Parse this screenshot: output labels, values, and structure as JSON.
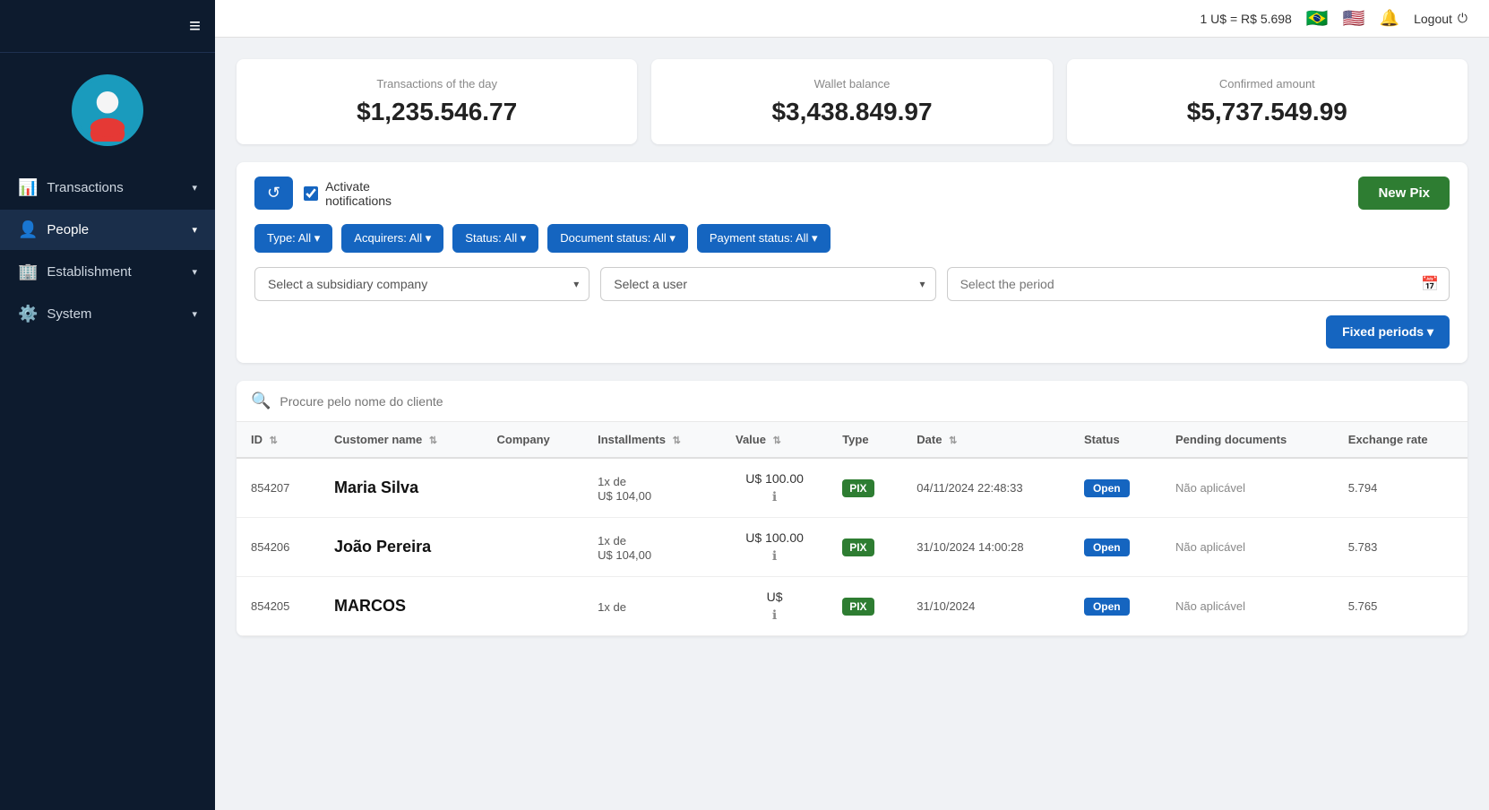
{
  "topbar": {
    "exchange_rate": "1 U$ = R$ 5.698",
    "bell_label": "🔔",
    "logout_label": "Logout"
  },
  "sidebar": {
    "hamburger": "≡",
    "nav_items": [
      {
        "id": "transactions",
        "label": "Transactions",
        "icon": "📊",
        "has_caret": true
      },
      {
        "id": "people",
        "label": "People",
        "icon": "👤",
        "has_caret": true
      },
      {
        "id": "establishment",
        "label": "Establishment",
        "icon": "🏢",
        "has_caret": true
      },
      {
        "id": "system",
        "label": "System",
        "icon": "⚙️",
        "has_caret": true
      }
    ]
  },
  "stats": [
    {
      "id": "transactions-of-day",
      "label": "Transactions of the day",
      "value": "$1,235.546.77"
    },
    {
      "id": "wallet-balance",
      "label": "Wallet balance",
      "value": "$3,438.849.97"
    },
    {
      "id": "confirmed-amount",
      "label": "Confirmed amount",
      "value": "$5,737.549.99"
    }
  ],
  "toolbar": {
    "refresh_label": "↺",
    "notify_label": "Activate\nnotifications",
    "new_pix_label": "New Pix",
    "filters": [
      {
        "id": "type",
        "label": "Type: All ▾"
      },
      {
        "id": "acquirers",
        "label": "Acquirers: All ▾"
      },
      {
        "id": "status",
        "label": "Status: All ▾"
      },
      {
        "id": "document-status",
        "label": "Document status: All ▾"
      },
      {
        "id": "payment-status",
        "label": "Payment status: All ▾"
      }
    ],
    "subsidiary_placeholder": "Select a subsidiary company",
    "user_placeholder": "Select a user",
    "period_placeholder": "Select the period",
    "fixed_periods_label": "Fixed periods ▾"
  },
  "search": {
    "placeholder": "Procure pelo nome do cliente"
  },
  "table": {
    "columns": [
      {
        "id": "id",
        "label": "ID",
        "sortable": true
      },
      {
        "id": "customer-name",
        "label": "Customer name",
        "sortable": true
      },
      {
        "id": "company",
        "label": "Company",
        "sortable": false
      },
      {
        "id": "installments",
        "label": "Installments",
        "sortable": true
      },
      {
        "id": "value",
        "label": "Value",
        "sortable": true
      },
      {
        "id": "type",
        "label": "Type",
        "sortable": false
      },
      {
        "id": "date",
        "label": "Date",
        "sortable": true
      },
      {
        "id": "status",
        "label": "Status",
        "sortable": false
      },
      {
        "id": "pending-documents",
        "label": "Pending documents",
        "sortable": false
      },
      {
        "id": "exchange-rate",
        "label": "Exchange rate",
        "sortable": false
      }
    ],
    "rows": [
      {
        "id": "854207",
        "customer_name": "Maria Silva",
        "company": "",
        "installments": "1x de",
        "installments2": "U$ 104,00",
        "value": "U$ 100.00",
        "type": "PIX",
        "date": "04/11/2024 22:48:33",
        "status": "Open",
        "pending_documents": "Não aplicável",
        "exchange_rate": "5.794"
      },
      {
        "id": "854206",
        "customer_name": "João Pereira",
        "company": "",
        "installments": "1x de",
        "installments2": "U$ 104,00",
        "value": "U$ 100.00",
        "type": "PIX",
        "date": "31/10/2024 14:00:28",
        "status": "Open",
        "pending_documents": "Não aplicável",
        "exchange_rate": "5.783"
      },
      {
        "id": "854205",
        "customer_name": "MARCOS",
        "company": "",
        "installments": "1x de",
        "installments2": "",
        "value": "U$",
        "type": "PIX",
        "date": "31/10/2024",
        "status": "Open",
        "pending_documents": "Não aplicável",
        "exchange_rate": "5.765"
      }
    ]
  }
}
